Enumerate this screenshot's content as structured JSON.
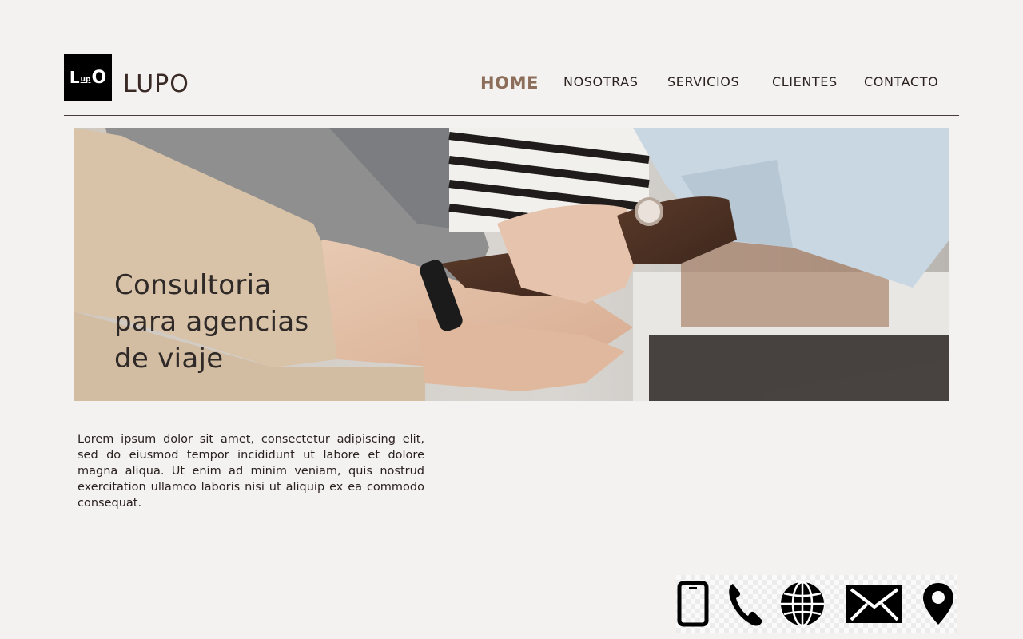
{
  "header": {
    "logo_text": [
      "L",
      "up",
      "O"
    ],
    "brand": "LUPO"
  },
  "nav": {
    "items": [
      {
        "label": "HOME",
        "active": true
      },
      {
        "label": "NOSOTRAS",
        "active": false
      },
      {
        "label": "SERVICIOS",
        "active": false
      },
      {
        "label": "CLIENTES",
        "active": false
      },
      {
        "label": "CONTACTO",
        "active": false
      }
    ]
  },
  "hero": {
    "title_lines": [
      "Consultoria",
      "para agencias",
      "de viaje"
    ],
    "image": "team-hands-stacked-photo"
  },
  "intro": {
    "text": "Lorem ipsum dolor sit amet, consectetur adipiscing elit, sed do eiusmod tempor incididunt ut labore et dolore magna aliqua. Ut enim ad minim veniam, quis nostrud exercitation ullamco laboris nisi ut aliquip ex ea commodo consequat."
  },
  "footer": {
    "icons": [
      "mobile-phone-icon",
      "phone-icon",
      "globe-icon",
      "mail-icon",
      "location-pin-icon"
    ]
  },
  "colors": {
    "background": "#f4f2f0",
    "active_nav": "#8c6e5a",
    "text": "#2b2220"
  }
}
